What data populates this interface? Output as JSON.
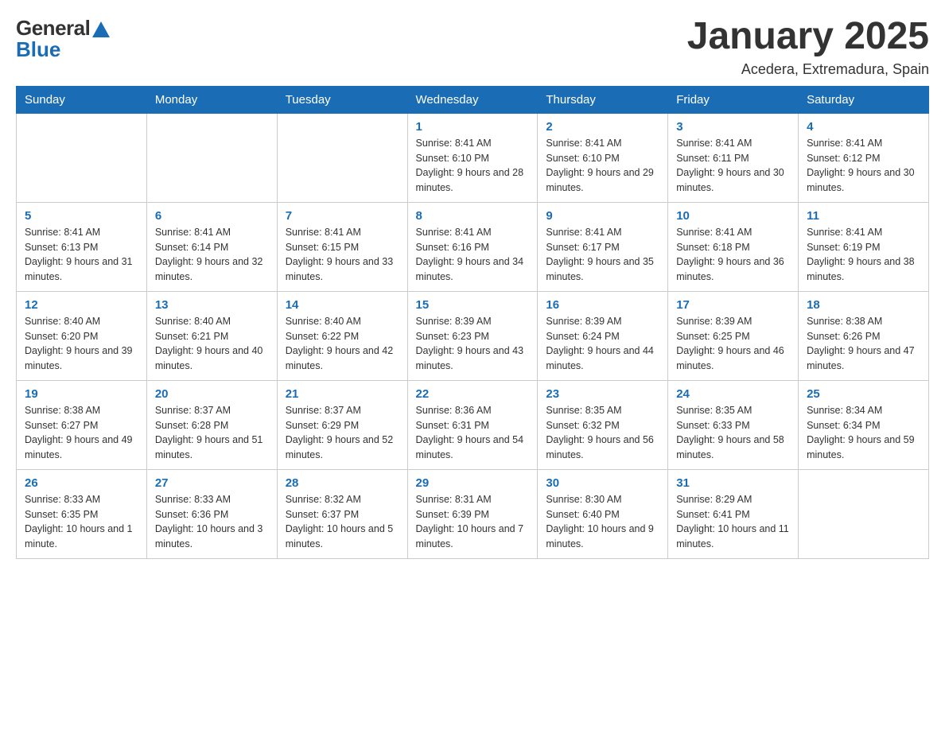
{
  "header": {
    "logo_general": "General",
    "logo_blue": "Blue",
    "title": "January 2025",
    "subtitle": "Acedera, Extremadura, Spain"
  },
  "days_of_week": [
    "Sunday",
    "Monday",
    "Tuesday",
    "Wednesday",
    "Thursday",
    "Friday",
    "Saturday"
  ],
  "weeks": [
    [
      {
        "day": "",
        "info": ""
      },
      {
        "day": "",
        "info": ""
      },
      {
        "day": "",
        "info": ""
      },
      {
        "day": "1",
        "info": "Sunrise: 8:41 AM\nSunset: 6:10 PM\nDaylight: 9 hours and 28 minutes."
      },
      {
        "day": "2",
        "info": "Sunrise: 8:41 AM\nSunset: 6:10 PM\nDaylight: 9 hours and 29 minutes."
      },
      {
        "day": "3",
        "info": "Sunrise: 8:41 AM\nSunset: 6:11 PM\nDaylight: 9 hours and 30 minutes."
      },
      {
        "day": "4",
        "info": "Sunrise: 8:41 AM\nSunset: 6:12 PM\nDaylight: 9 hours and 30 minutes."
      }
    ],
    [
      {
        "day": "5",
        "info": "Sunrise: 8:41 AM\nSunset: 6:13 PM\nDaylight: 9 hours and 31 minutes."
      },
      {
        "day": "6",
        "info": "Sunrise: 8:41 AM\nSunset: 6:14 PM\nDaylight: 9 hours and 32 minutes."
      },
      {
        "day": "7",
        "info": "Sunrise: 8:41 AM\nSunset: 6:15 PM\nDaylight: 9 hours and 33 minutes."
      },
      {
        "day": "8",
        "info": "Sunrise: 8:41 AM\nSunset: 6:16 PM\nDaylight: 9 hours and 34 minutes."
      },
      {
        "day": "9",
        "info": "Sunrise: 8:41 AM\nSunset: 6:17 PM\nDaylight: 9 hours and 35 minutes."
      },
      {
        "day": "10",
        "info": "Sunrise: 8:41 AM\nSunset: 6:18 PM\nDaylight: 9 hours and 36 minutes."
      },
      {
        "day": "11",
        "info": "Sunrise: 8:41 AM\nSunset: 6:19 PM\nDaylight: 9 hours and 38 minutes."
      }
    ],
    [
      {
        "day": "12",
        "info": "Sunrise: 8:40 AM\nSunset: 6:20 PM\nDaylight: 9 hours and 39 minutes."
      },
      {
        "day": "13",
        "info": "Sunrise: 8:40 AM\nSunset: 6:21 PM\nDaylight: 9 hours and 40 minutes."
      },
      {
        "day": "14",
        "info": "Sunrise: 8:40 AM\nSunset: 6:22 PM\nDaylight: 9 hours and 42 minutes."
      },
      {
        "day": "15",
        "info": "Sunrise: 8:39 AM\nSunset: 6:23 PM\nDaylight: 9 hours and 43 minutes."
      },
      {
        "day": "16",
        "info": "Sunrise: 8:39 AM\nSunset: 6:24 PM\nDaylight: 9 hours and 44 minutes."
      },
      {
        "day": "17",
        "info": "Sunrise: 8:39 AM\nSunset: 6:25 PM\nDaylight: 9 hours and 46 minutes."
      },
      {
        "day": "18",
        "info": "Sunrise: 8:38 AM\nSunset: 6:26 PM\nDaylight: 9 hours and 47 minutes."
      }
    ],
    [
      {
        "day": "19",
        "info": "Sunrise: 8:38 AM\nSunset: 6:27 PM\nDaylight: 9 hours and 49 minutes."
      },
      {
        "day": "20",
        "info": "Sunrise: 8:37 AM\nSunset: 6:28 PM\nDaylight: 9 hours and 51 minutes."
      },
      {
        "day": "21",
        "info": "Sunrise: 8:37 AM\nSunset: 6:29 PM\nDaylight: 9 hours and 52 minutes."
      },
      {
        "day": "22",
        "info": "Sunrise: 8:36 AM\nSunset: 6:31 PM\nDaylight: 9 hours and 54 minutes."
      },
      {
        "day": "23",
        "info": "Sunrise: 8:35 AM\nSunset: 6:32 PM\nDaylight: 9 hours and 56 minutes."
      },
      {
        "day": "24",
        "info": "Sunrise: 8:35 AM\nSunset: 6:33 PM\nDaylight: 9 hours and 58 minutes."
      },
      {
        "day": "25",
        "info": "Sunrise: 8:34 AM\nSunset: 6:34 PM\nDaylight: 9 hours and 59 minutes."
      }
    ],
    [
      {
        "day": "26",
        "info": "Sunrise: 8:33 AM\nSunset: 6:35 PM\nDaylight: 10 hours and 1 minute."
      },
      {
        "day": "27",
        "info": "Sunrise: 8:33 AM\nSunset: 6:36 PM\nDaylight: 10 hours and 3 minutes."
      },
      {
        "day": "28",
        "info": "Sunrise: 8:32 AM\nSunset: 6:37 PM\nDaylight: 10 hours and 5 minutes."
      },
      {
        "day": "29",
        "info": "Sunrise: 8:31 AM\nSunset: 6:39 PM\nDaylight: 10 hours and 7 minutes."
      },
      {
        "day": "30",
        "info": "Sunrise: 8:30 AM\nSunset: 6:40 PM\nDaylight: 10 hours and 9 minutes."
      },
      {
        "day": "31",
        "info": "Sunrise: 8:29 AM\nSunset: 6:41 PM\nDaylight: 10 hours and 11 minutes."
      },
      {
        "day": "",
        "info": ""
      }
    ]
  ]
}
